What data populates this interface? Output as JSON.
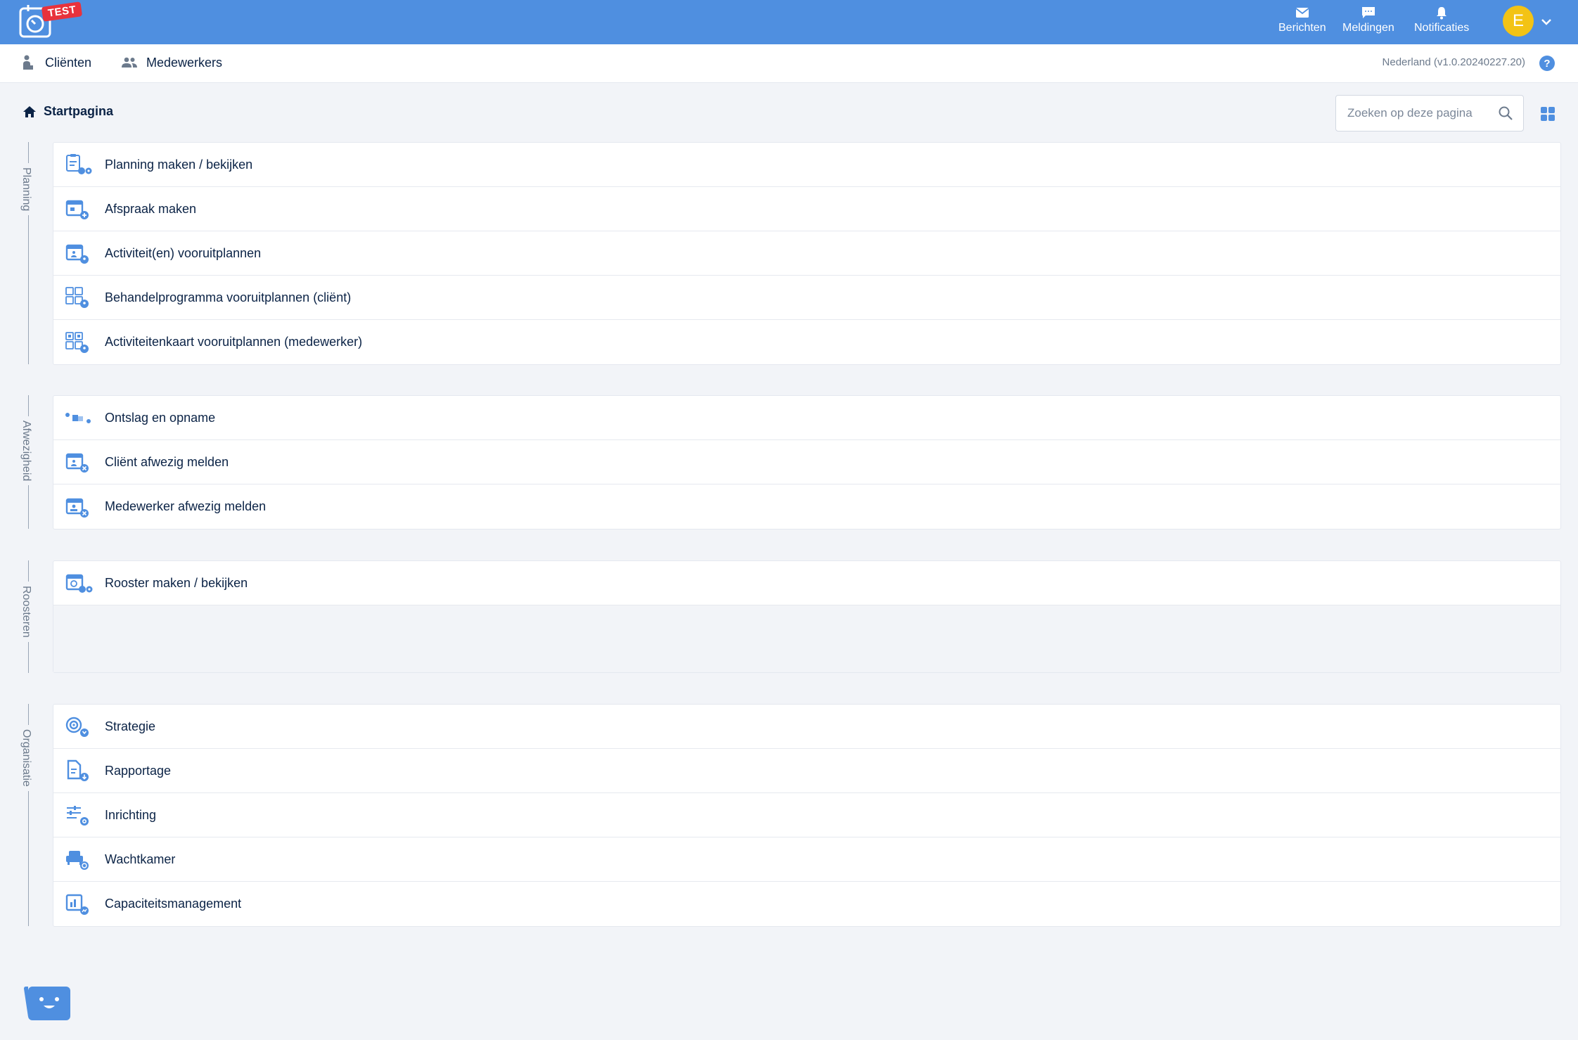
{
  "topbar": {
    "badge": "TEST",
    "actions": [
      {
        "label": "Berichten",
        "icon": "mail-icon"
      },
      {
        "label": "Meldingen",
        "icon": "chat-icon"
      },
      {
        "label": "Notificaties",
        "icon": "bell-icon"
      }
    ],
    "avatar_initial": "E",
    "colors": {
      "bar": "#4f8fe0",
      "avatar": "#f3c315",
      "badge": "#e8323c"
    }
  },
  "nav": {
    "items": [
      {
        "label": "Cliënten",
        "icon": "client-icon"
      },
      {
        "label": "Medewerkers",
        "icon": "employees-icon"
      }
    ],
    "version": "Nederland (v1.0.20240227.20)"
  },
  "page": {
    "breadcrumb": "Startpagina",
    "search_placeholder": "Zoeken op deze pagina"
  },
  "sections": [
    {
      "title": "Planning",
      "items": [
        {
          "label": "Planning maken / bekijken",
          "icon": "planning-view-icon"
        },
        {
          "label": "Afspraak maken",
          "icon": "calendar-add-icon"
        },
        {
          "label": "Activiteit(en) vooruitplannen",
          "icon": "calendar-person-icon"
        },
        {
          "label": "Behandelprogramma vooruitplannen (cliënt)",
          "icon": "program-grid-icon"
        },
        {
          "label": "Activiteitenkaart vooruitplannen (medewerker)",
          "icon": "activity-card-icon"
        }
      ]
    },
    {
      "title": "Afwezigheid",
      "items": [
        {
          "label": "Ontslag en opname",
          "icon": "discharge-admission-icon"
        },
        {
          "label": "Cliënt afwezig melden",
          "icon": "client-absent-icon"
        },
        {
          "label": "Medewerker afwezig melden",
          "icon": "employee-absent-icon"
        }
      ]
    },
    {
      "title": "Roosteren",
      "items": [
        {
          "label": "Rooster maken / bekijken",
          "icon": "roster-icon"
        }
      ]
    },
    {
      "title": "Organisatie",
      "items": [
        {
          "label": "Strategie",
          "icon": "strategy-icon"
        },
        {
          "label": "Rapportage",
          "icon": "report-icon"
        },
        {
          "label": "Inrichting",
          "icon": "settings-sliders-icon"
        },
        {
          "label": "Wachtkamer",
          "icon": "waiting-room-icon"
        },
        {
          "label": "Capaciteitsmanagement",
          "icon": "capacity-chart-icon"
        }
      ]
    }
  ],
  "accent": "#4f8fe0"
}
